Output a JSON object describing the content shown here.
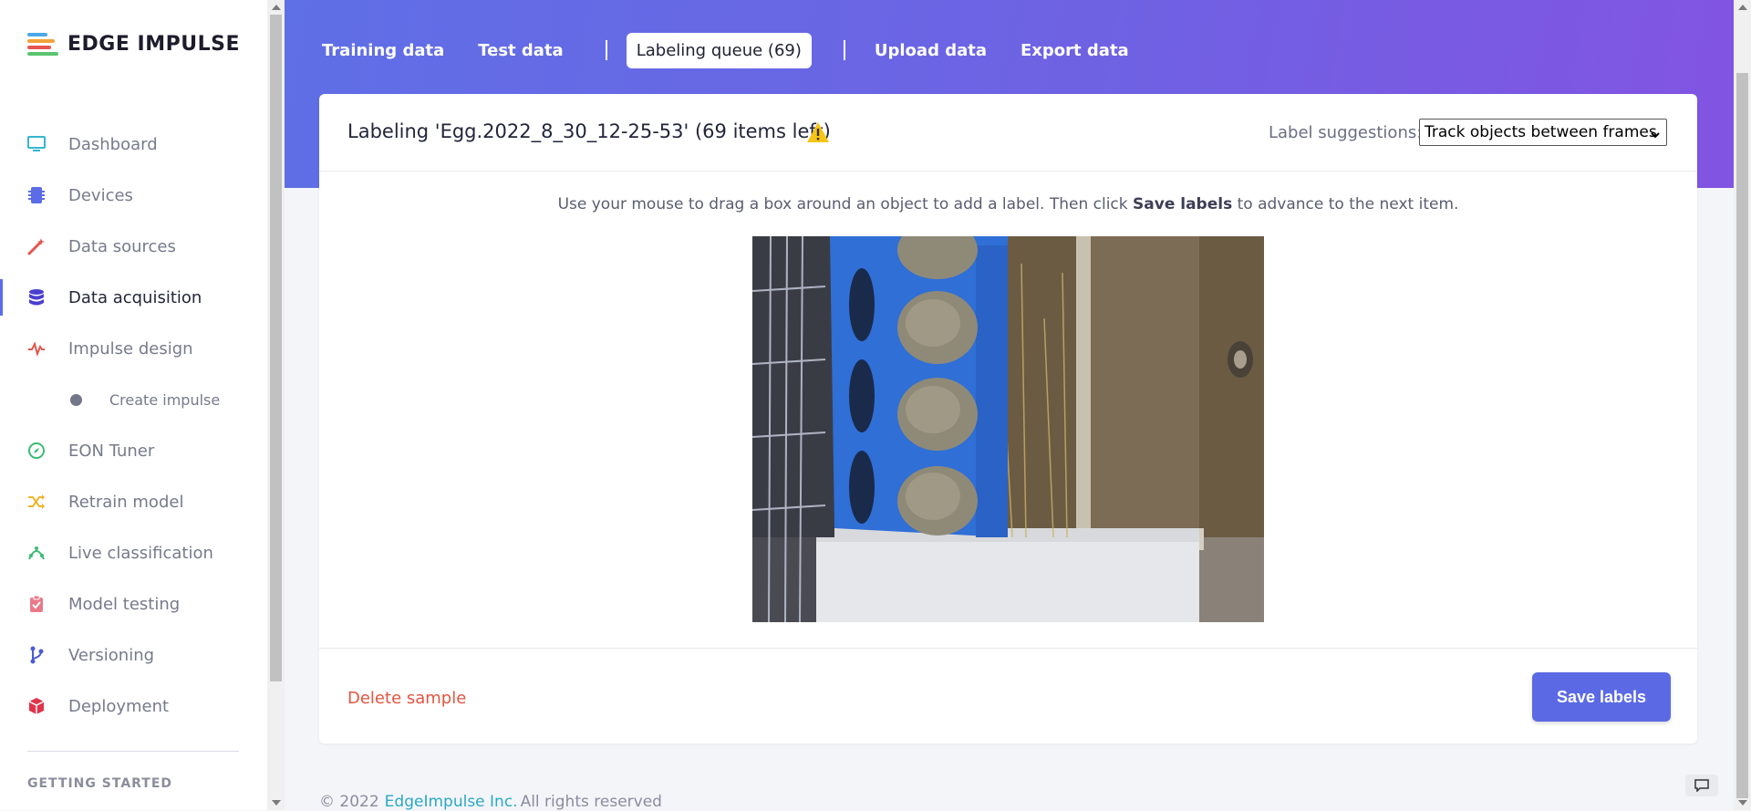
{
  "brand": {
    "name": "EDGE IMPULSE",
    "bar_colors": [
      "#4aa8e8",
      "#f0a23a",
      "#e4564f",
      "#5ac46f"
    ]
  },
  "sidebar": {
    "items": [
      {
        "label": "Dashboard",
        "icon": "monitor-icon",
        "color": "#35b6d1"
      },
      {
        "label": "Devices",
        "icon": "chip-icon",
        "color": "#5b6ce6"
      },
      {
        "label": "Data sources",
        "icon": "magic-wand-icon",
        "color": "#e4564f"
      },
      {
        "label": "Data acquisition",
        "icon": "database-icon",
        "color": "#4b3fcf",
        "active": true
      },
      {
        "label": "Impulse design",
        "icon": "pulse-icon",
        "color": "#e4564f"
      },
      {
        "label": "Create impulse",
        "icon": "dot-icon",
        "sub": true
      },
      {
        "label": "EON Tuner",
        "icon": "compass-icon",
        "color": "#3bbb74"
      },
      {
        "label": "Retrain model",
        "icon": "shuffle-icon",
        "color": "#f0b429"
      },
      {
        "label": "Live classification",
        "icon": "signal-icon",
        "color": "#3bbb74"
      },
      {
        "label": "Model testing",
        "icon": "clipboard-check-icon",
        "color": "#e97a8a"
      },
      {
        "label": "Versioning",
        "icon": "branch-icon",
        "color": "#4b5bd6"
      },
      {
        "label": "Deployment",
        "icon": "box-icon",
        "color": "#e0344b"
      }
    ],
    "section_label": "GETTING STARTED"
  },
  "tabs": [
    {
      "label": "Training data"
    },
    {
      "label": "Test data"
    },
    {
      "label": "Labeling queue (69)",
      "active": true
    },
    {
      "label": "Upload data"
    },
    {
      "label": "Export data"
    }
  ],
  "card": {
    "title": "Labeling 'Egg.2022_8_30_12-25-53' (69 items left)",
    "warning_icon": "warning-triangle-icon",
    "suggestions_label": "Label suggestions:",
    "suggestions_value": "Track objects between frames",
    "instruction_prefix": "Use your mouse to drag a box around an object to add a label. Then click ",
    "instruction_bold": "Save labels",
    "instruction_suffix": " to advance to the next item.",
    "delete_label": "Delete sample",
    "save_label": "Save labels"
  },
  "footer": {
    "copyright": "© 2022",
    "company": "EdgeImpulse Inc.",
    "rights": "All rights reserved"
  }
}
